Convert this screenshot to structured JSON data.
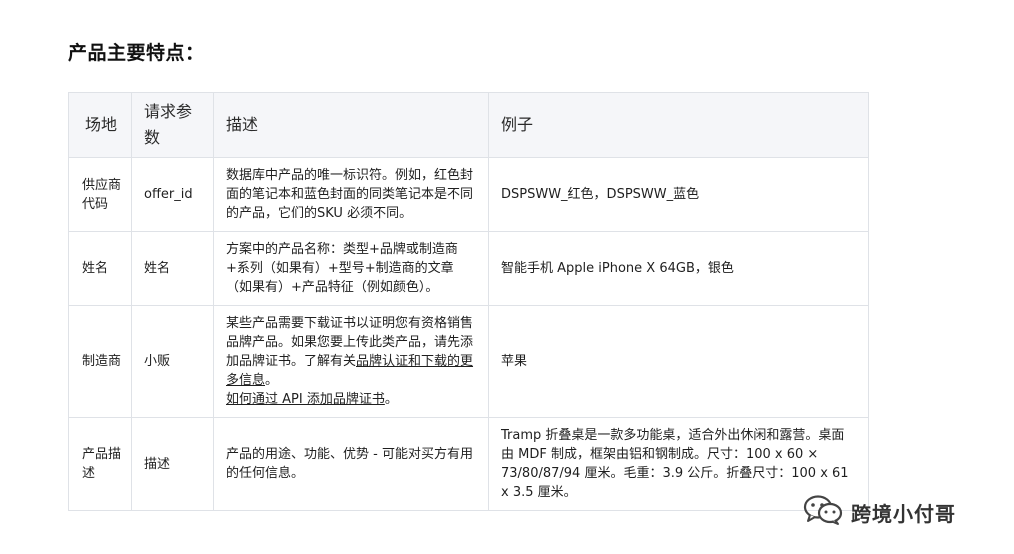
{
  "heading": "产品主要特点：",
  "table": {
    "headers": [
      "场地",
      "请求参数",
      "描述",
      "例子"
    ],
    "rows": [
      {
        "field": "供应商代码",
        "param": "offer_id",
        "description": "数据库中产品的唯一标识符。例如，红色封面的笔记本和蓝色封面的同类笔记本是不同的产品，它们的SKU 必须不同。",
        "example": "DSPSWW_红色，DSPSWW_蓝色"
      },
      {
        "field": "姓名",
        "param": "姓名",
        "description": "方案中的产品名称：类型+品牌或制造商+系列（如果有）+型号+制造商的文章（如果有）+产品特征（例如颜色）。",
        "example": "智能手机 Apple iPhone X 64GB，银色"
      },
      {
        "field": "制造商",
        "param": "小贩",
        "description_pre": "某些产品需要下载证书以证明您有资格销售品牌产品。如果您要上传此类产品，请先添加品牌证书。了解有关",
        "description_link1": "品牌认证和下载的更多信息",
        "description_mid": "。",
        "description_link2": "如何通过 API 添加品牌证书",
        "description_post": "。",
        "example": "苹果"
      },
      {
        "field": "产品描述",
        "param": "描述",
        "description": "产品的用途、功能、优势 - 可能对买方有用的任何信息。",
        "example": "Tramp 折叠桌是一款多功能桌，适合外出休闲和露营。桌面由 MDF 制成，框架由铝和钢制成。尺寸：100 x 60 × 73/80/87/94 厘米。毛重：3.9 公斤。折叠尺寸：100 x 61 x 3.5 厘米。"
      }
    ]
  },
  "watermark": {
    "text": "跨境小付哥",
    "icon": "wechat-icon"
  }
}
